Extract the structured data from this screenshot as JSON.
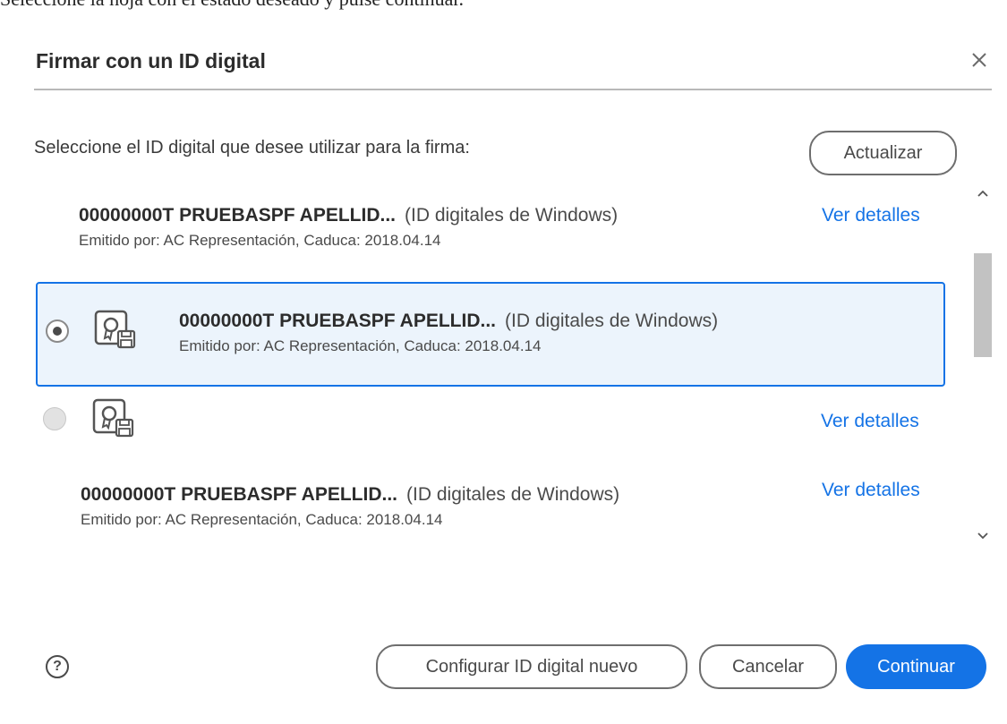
{
  "top_text": "Seleccione la hoja con el estado deseado y pulse continuar.",
  "dialog": {
    "title": "Firmar con un ID digital",
    "close_icon": "close-icon",
    "prompt": "Seleccione el ID digital que desee utilizar para la firma:",
    "refresh_label": "Actualizar"
  },
  "ids": [
    {
      "name": "00000000T PRUEBASPF APELLID...",
      "type": "(ID digitales de Windows)",
      "issuer": "Emitido por: AC Representación, Caduca: 2018.04.14",
      "details": "Ver detalles",
      "selected": false
    },
    {
      "name": "00000000T PRUEBASPF APELLID...",
      "type": "(ID digitales de Windows)",
      "issuer": "Emitido por: AC Representación, Caduca: 2018.04.14",
      "selected": true
    },
    {
      "name": "",
      "type": "",
      "issuer": "",
      "details": "Ver detalles",
      "selected": false
    },
    {
      "name": "00000000T PRUEBASPF APELLID...",
      "type": "(ID digitales de Windows)",
      "issuer": "Emitido por: AC Representación, Caduca: 2018.04.14",
      "details": "Ver detalles",
      "selected": false
    }
  ],
  "footer": {
    "help_icon": "help-icon",
    "help_glyph": "?",
    "configure_label": "Configurar ID digital nuevo",
    "cancel_label": "Cancelar",
    "continue_label": "Continuar"
  },
  "colors": {
    "accent": "#1473e6",
    "selected_bg": "#ecf4fc"
  }
}
